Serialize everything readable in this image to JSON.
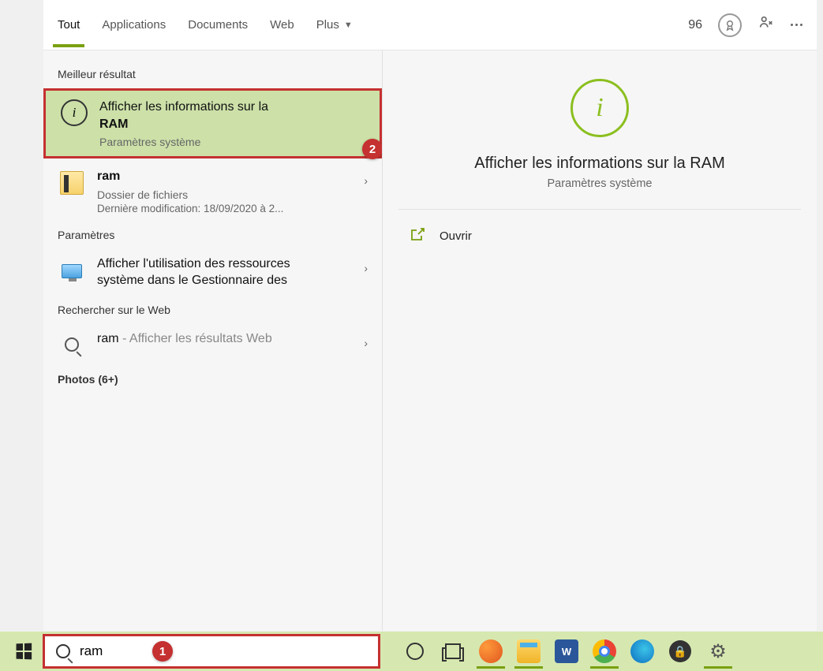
{
  "header": {
    "tabs": [
      "Tout",
      "Applications",
      "Documents",
      "Web",
      "Plus"
    ],
    "score": "96"
  },
  "left": {
    "best_label": "Meilleur résultat",
    "best": {
      "title_line1": "Afficher les informations sur la",
      "title_line2": "RAM",
      "sub": "Paramètres système"
    },
    "folder": {
      "title": "ram",
      "sub": "Dossier de fichiers",
      "meta": "Dernière modification: 18/09/2020 à 2..."
    },
    "params_label": "Paramètres",
    "taskmgr": {
      "line1": "Afficher l'utilisation des ressources",
      "line2": "système dans le Gestionnaire des"
    },
    "web_label": "Rechercher sur le Web",
    "web_search": {
      "query": "ram",
      "suffix": " - Afficher les résultats Web"
    },
    "photos_label": "Photos (6+)"
  },
  "detail": {
    "title": "Afficher les informations sur la RAM",
    "sub": "Paramètres système",
    "open": "Ouvrir"
  },
  "taskbar": {
    "search_value": "ram"
  },
  "annotations": {
    "one": "1",
    "two": "2"
  }
}
